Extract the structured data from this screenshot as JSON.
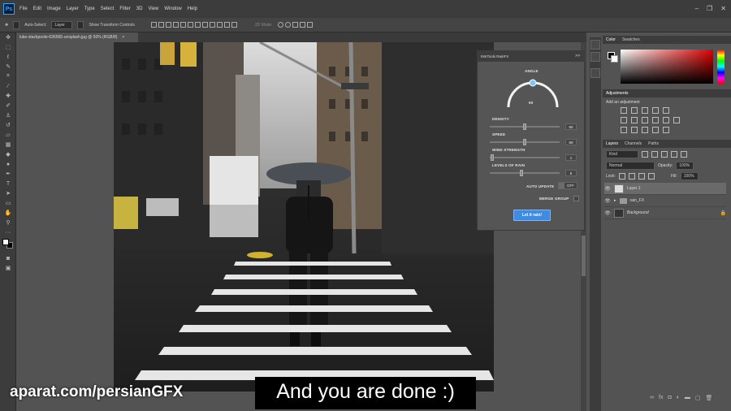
{
  "app": {
    "logo": "Ps"
  },
  "menubar": [
    "File",
    "Edit",
    "Image",
    "Layer",
    "Type",
    "Select",
    "Filter",
    "3D",
    "View",
    "Window",
    "Help"
  ],
  "window_controls": [
    "–",
    "❐",
    "✕"
  ],
  "options": {
    "auto_select_label": "Auto-Select:",
    "auto_select_value": "Layer",
    "transform_label": "Show Transform Controls",
    "mode_3d": "3D Mode:"
  },
  "document": {
    "tab_title": "luke-stackpoole-636565-unsplash.jpg @ 50% (RGB/8)",
    "tab_close": "×"
  },
  "rainfx": {
    "title": "INKTools RainFX",
    "collapse": ">>",
    "angle_label": "ANGLE",
    "angle_value": "90",
    "density_label": "DENSITY",
    "density_value": "50",
    "density_level": 0.5,
    "speed_label": "SPEED",
    "speed_value": "50",
    "speed_level": 0.5,
    "wind_label": "WIND STRENGTH",
    "wind_value": "1",
    "wind_level": 0.01,
    "levels_label": "LEVELS OF RAIN",
    "levels_value": "5",
    "levels_level": 0.45,
    "auto_update_label": "AUTO UPDATE",
    "auto_update_state": "OFF",
    "merge_group_label": "MERGE GROUP",
    "button_label": "Let it rain!"
  },
  "panels": {
    "color_tab": "Color",
    "swatches_tab": "Swatches",
    "adjustments_tab": "Adjustments",
    "add_adjustment": "Add an adjustment",
    "layers_tab": "Layers",
    "channels_tab": "Channels",
    "paths_tab": "Paths",
    "kind_label": "Kind",
    "blend_mode": "Normal",
    "opacity_label": "Opacity:",
    "opacity_value": "100%",
    "lock_label": "Lock:",
    "fill_label": "Fill:",
    "fill_value": "100%"
  },
  "layers": [
    {
      "name": "Layer 1"
    },
    {
      "name": "rain_FX"
    },
    {
      "name": "Background"
    }
  ],
  "overlay": {
    "watermark": "aparat.com/persianGFX",
    "subtitle": "And you are done :)"
  },
  "colors": {
    "accent": "#3f8be0",
    "panel_bg": "#535353",
    "chrome": "#3c3c3c"
  }
}
